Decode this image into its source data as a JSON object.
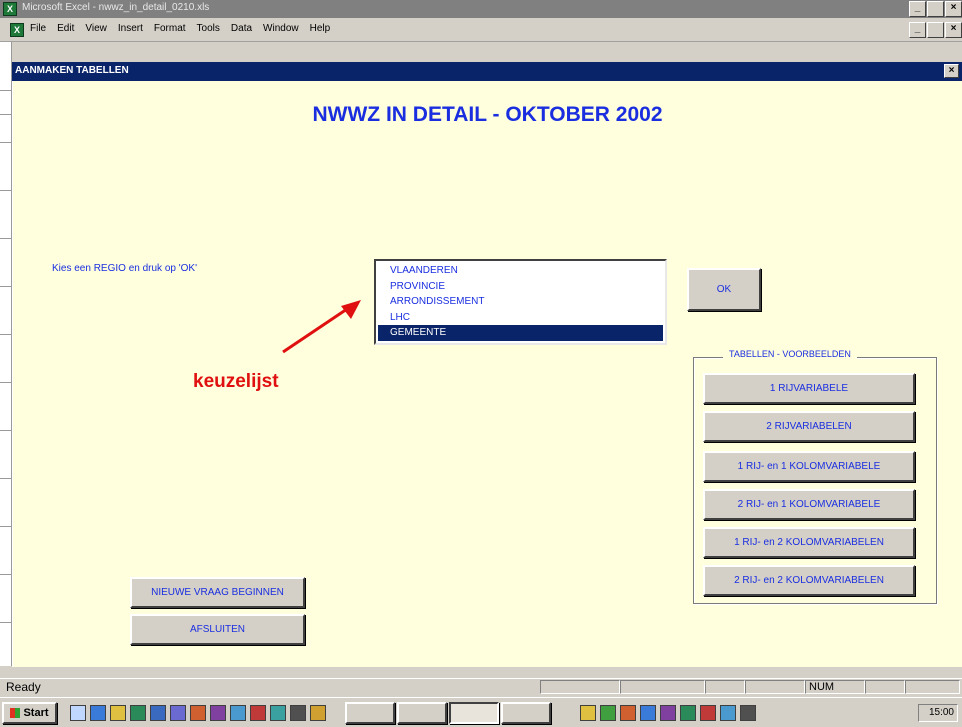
{
  "window": {
    "title": "Microsoft Excel - nwwz_in_detail_0210.xls",
    "controls": [
      "_",
      " ",
      "×"
    ]
  },
  "menubar": {
    "items": [
      "File",
      "Edit",
      "View",
      "Insert",
      "Format",
      "Tools",
      "Data",
      "Window",
      "Help"
    ],
    "doc_controls": [
      "_",
      " ",
      "×"
    ]
  },
  "dialog": {
    "title": "AANMAKEN TABELLEN",
    "heading": "NWWZ IN DETAIL - OKTOBER 2002",
    "prompt": "Kies een REGIO en druk op 'OK'",
    "listbox": {
      "items": [
        "VLAANDEREN",
        "PROVINCIE",
        "ARRONDISSEMENT",
        "LHC",
        "GEMEENTE"
      ],
      "selected_index": 4
    },
    "ok_label": "OK",
    "group": {
      "label": "TABELLEN - VOORBEELDEN",
      "buttons": [
        "1 RIJVARIABELE",
        "2 RIJVARIABELEN",
        "1 RIJ- en 1 KOLOMVARIABELE",
        "2 RIJ- en 1 KOLOMVARIABELE",
        "1 RIJ- en 2 KOLOMVARIABELEN",
        "2 RIJ- en 2 KOLOMVARIABELEN"
      ]
    },
    "new_question_label": "NIEUWE VRAAG BEGINNEN",
    "close_label": "AFSLUITEN"
  },
  "annotation": {
    "label": "keuzelijst",
    "color": "#e01010"
  },
  "statusbar": {
    "status": "Ready",
    "num": "NUM"
  },
  "taskbar": {
    "start_label": "Start",
    "clock": "15:00"
  },
  "colors": {
    "dialog_bg": "#ffffdd",
    "text_blue": "#1a2ee0",
    "selection": "#0a246a"
  }
}
